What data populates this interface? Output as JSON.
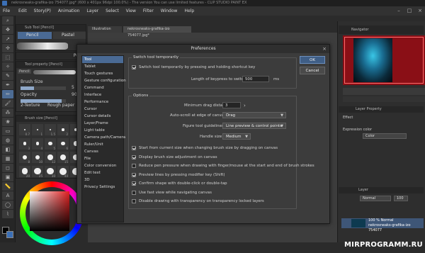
{
  "window": {
    "title": "nekrosneaks-grafika-izo 754077.jpg* (600 x 401px 96dpi 100.0%) - The version You can use limited features - CLIP STUDIO PAINT EX"
  },
  "menu": [
    "File",
    "Edit",
    "Story(P)",
    "Animation",
    "Layer",
    "Select",
    "View",
    "Filter",
    "Window",
    "Help"
  ],
  "left": {
    "subtool_header": "Sub Tool [Pencil]",
    "subtools": [
      "Pencil",
      "Pastel"
    ],
    "subtool_truncated": "Pe",
    "property_header": "Tool property [Pencil]",
    "property_name": "Pencil",
    "brush_size_label": "Brush Size",
    "brush_size_value": 5,
    "opacity_label": "Opacity",
    "opacity_value": 90,
    "texture_label": "2-Texture",
    "texture_value": "Rough paper",
    "brush_size_palette_header": "Brush size [Pencil]",
    "brush_sizes": [
      "0.7",
      "1",
      "1.5",
      "2",
      "2.5",
      "3",
      "4",
      "5",
      "6",
      "7",
      "8",
      "10",
      "12",
      "15",
      "17",
      "20",
      "25",
      "30",
      "40",
      "50"
    ]
  },
  "document_tabs": [
    "Illustration",
    "nekrosneaks-grafika-izo 754077.jpg*"
  ],
  "navigator": {
    "header": "Navigator"
  },
  "right": {
    "layer_property_header": "Layer Property",
    "effect_label": "Effect",
    "expression_color_label": "Expression color",
    "expression_color_value": "Color",
    "layer_header": "Layer",
    "blend_mode": "Normal",
    "opacity_value": "100",
    "layer_name_line1": "100 % Normal",
    "layer_name_line2": "nekrosneaks-grafika-izo 754077"
  },
  "dialog": {
    "title": "Preferences",
    "ok_label": "OK",
    "cancel_label": "Cancel",
    "categories": [
      "Tool",
      "Tablet",
      "Touch gestures",
      "Gesture configuration",
      "Command",
      "Interface",
      "Performance",
      "Cursor",
      "Cursor details",
      "Layer/Frame",
      "Light table",
      "Camera path/Camera",
      "Ruler/Unit",
      "Canvas",
      "File",
      "Color conversion",
      "Edit text",
      "3D",
      "Privacy Settings"
    ],
    "selected_category": 0,
    "switch_group_label": "Switch tool temporarily",
    "switch_checkbox_label": "Switch tool temporarily by pressing and holding shortcut key",
    "switch_checked": true,
    "keypress_label": "Length of keypress to switch tools",
    "keypress_value": "500",
    "keypress_unit": "ms",
    "options_group_label": "Options",
    "min_drag_label": "Minimum drag distance",
    "min_drag_value": "3",
    "autoscroll_label": "Auto-scroll at edge of canvas",
    "autoscroll_value": "Drag",
    "figure_guidelines_label": "Figure tool guidelines",
    "figure_guidelines_value": "Line preview & control points",
    "handle_size_label": "Handle size",
    "handle_size_value": "Medium",
    "options": [
      {
        "label": "Start from current size when changing brush size by dragging on canvas",
        "checked": true
      },
      {
        "label": "Display brush size adjustment on canvas",
        "checked": true
      },
      {
        "label": "Reduce pen pressure when drawing with finger/mouse at the start and end of brush strokes",
        "checked": false
      },
      {
        "label": "Preview lines by pressing modifier key (Shift)",
        "checked": true
      },
      {
        "label": "Confirm shape with double-click or double-tap",
        "checked": true
      },
      {
        "label": "Use fast view while navigating canvas",
        "checked": false
      },
      {
        "label": "Disable drawing with transparency on transparency locked layers",
        "checked": false
      }
    ]
  },
  "watermark": "MIRPROGRAMM.RU",
  "colors": {
    "accent": "#4a6a94",
    "navigator_bg": "#8a0f16",
    "portrait": "#39c6e6"
  }
}
